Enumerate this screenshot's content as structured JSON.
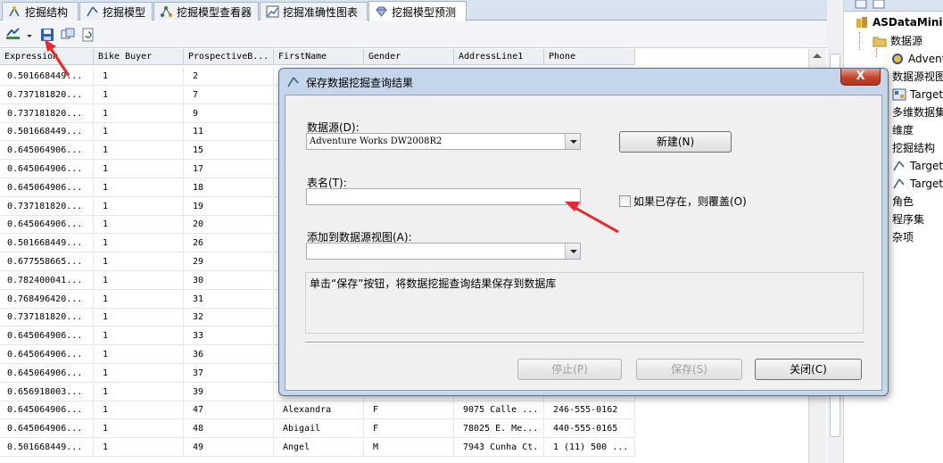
{
  "tabs": [
    {
      "label": "挖掘结构",
      "icon": "mining-structure-icon"
    },
    {
      "label": "挖掘模型",
      "icon": "mining-model-icon"
    },
    {
      "label": "挖掘模型查看器",
      "icon": "mining-viewer-icon"
    },
    {
      "label": "挖掘准确性图表",
      "icon": "accuracy-chart-icon"
    },
    {
      "label": "挖掘模型预测",
      "icon": "model-prediction-icon",
      "active": true
    }
  ],
  "grid": {
    "columns": [
      "Expression",
      "Bike Buyer",
      "ProspectiveB...",
      "FirstName",
      "Gender",
      "AddressLine1",
      "Phone"
    ],
    "rows": [
      [
        "0.501668449...",
        "1",
        "2",
        "",
        "",
        "",
        ""
      ],
      [
        "0.737181820...",
        "1",
        "7",
        "",
        "",
        "",
        ""
      ],
      [
        "0.737181820...",
        "1",
        "9",
        "",
        "",
        "",
        ""
      ],
      [
        "0.501668449...",
        "1",
        "11",
        "",
        "",
        "",
        ""
      ],
      [
        "0.645064906...",
        "1",
        "15",
        "",
        "",
        "",
        ""
      ],
      [
        "0.645064906...",
        "1",
        "17",
        "",
        "",
        "",
        ""
      ],
      [
        "0.645064906...",
        "1",
        "18",
        "",
        "",
        "",
        ""
      ],
      [
        "0.737181820...",
        "1",
        "19",
        "",
        "",
        "",
        ""
      ],
      [
        "0.645064906...",
        "1",
        "20",
        "",
        "",
        "",
        ""
      ],
      [
        "0.501668449...",
        "1",
        "26",
        "",
        "",
        "",
        ""
      ],
      [
        "0.677558665...",
        "1",
        "29",
        "",
        "",
        "",
        ""
      ],
      [
        "0.782400041...",
        "1",
        "30",
        "",
        "",
        "",
        ""
      ],
      [
        "0.768496420...",
        "1",
        "31",
        "",
        "",
        "",
        ""
      ],
      [
        "0.737181820...",
        "1",
        "32",
        "",
        "",
        "",
        ""
      ],
      [
        "0.645064906...",
        "1",
        "33",
        "",
        "",
        "",
        ""
      ],
      [
        "0.645064906...",
        "1",
        "36",
        "",
        "",
        "",
        ""
      ],
      [
        "0.645064906...",
        "1",
        "37",
        "",
        "",
        "",
        ""
      ],
      [
        "0.656918003...",
        "1",
        "39",
        "",
        "",
        "",
        ""
      ],
      [
        "0.645064906...",
        "1",
        "47",
        "Alexandra",
        "F",
        "9075 Calle ...",
        "246-555-0162"
      ],
      [
        "0.645064906...",
        "1",
        "48",
        "Abigail",
        "F",
        "78025 E. Me...",
        "440-555-0165"
      ],
      [
        "0.501668449...",
        "1",
        "49",
        "Angel",
        "M",
        "7943 Cunha Ct.",
        "1 (11) 500 ..."
      ]
    ]
  },
  "solution": {
    "project": "ASDataMinin",
    "items": [
      {
        "label": "数据源",
        "icon": "folder-icon"
      },
      {
        "label": "Advent",
        "icon": "data-source-icon"
      },
      {
        "label": "数据源视图",
        "icon": "none"
      },
      {
        "label": "Target",
        "icon": "data-source-view-icon"
      },
      {
        "label": "多维数据集",
        "icon": "none"
      },
      {
        "label": "维度",
        "icon": "none"
      },
      {
        "label": "挖掘结构",
        "icon": "none"
      },
      {
        "label": "Target",
        "icon": "mining-structure-icon"
      },
      {
        "label": "Target",
        "icon": "mining-structure-icon"
      },
      {
        "label": "角色",
        "icon": "none"
      },
      {
        "label": "程序集",
        "icon": "none"
      },
      {
        "label": "杂项",
        "icon": "none"
      }
    ]
  },
  "dialog": {
    "title": "保存数据挖掘查询结果",
    "close": "X",
    "datasource_label": "数据源(D):",
    "datasource_value": "Adventure Works DW2008R2",
    "new_button": "新建(N)",
    "table_label": "表名(T):",
    "table_value": "",
    "overwrite_label": "如果已存在，则覆盖(O)",
    "dsv_label": "添加到数据源视图(A):",
    "dsv_value": "",
    "info_text": "单击“保存”按钮，将数据挖掘查询结果保存到数据库",
    "stop_button": "停止(P)",
    "save_button": "保存(S)",
    "close_button": "关闭(C)"
  },
  "colors": {
    "accent_red": "#e8282e",
    "dialog_frame": "#c5d6ea",
    "tab_strip": "#d9e3ef"
  }
}
